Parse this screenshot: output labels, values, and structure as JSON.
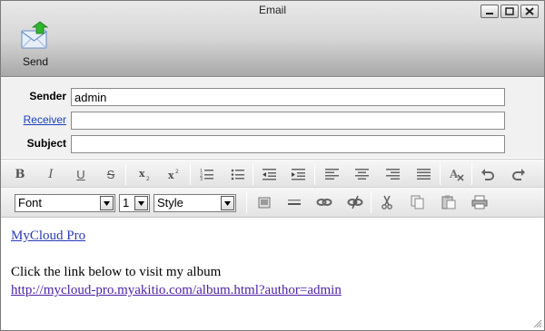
{
  "window": {
    "title": "Email",
    "controls": [
      "minimize",
      "maximize",
      "close"
    ]
  },
  "toolbar": {
    "send_label": "Send",
    "send_icon": "envelope-send-icon"
  },
  "header": {
    "sender_label": "Sender",
    "sender_value": "admin",
    "receiver_label": "Receiver",
    "receiver_value": "",
    "subject_label": "Subject",
    "subject_value": ""
  },
  "format_bar": {
    "buttons": [
      "bold",
      "italic",
      "underline",
      "strikethrough",
      "subscript",
      "superscript",
      "ordered-list",
      "unordered-list",
      "outdent",
      "indent",
      "align-left",
      "align-center",
      "align-right",
      "align-justify",
      "remove-format",
      "undo",
      "redo"
    ],
    "bold_glyph": "B",
    "italic_glyph": "I",
    "underline_glyph": "U",
    "strike_glyph": "S"
  },
  "format_bar2": {
    "font_select": "Font",
    "size_select": "1",
    "style_select": "Style",
    "buttons": [
      "insert-image",
      "horizontal-rule",
      "link",
      "unlink",
      "cut",
      "copy",
      "paste",
      "print"
    ]
  },
  "body": {
    "title_link": "MyCloud Pro",
    "line1": "Click the link below to visit my album",
    "album_link": "http://mycloud-pro.myakitio.com/album.html?author=admin"
  },
  "colors": {
    "link": "#2a3ab8",
    "visited_link": "#4b1fa3",
    "label_link": "#1a3fbf",
    "send_arrow": "#2fb52f"
  }
}
